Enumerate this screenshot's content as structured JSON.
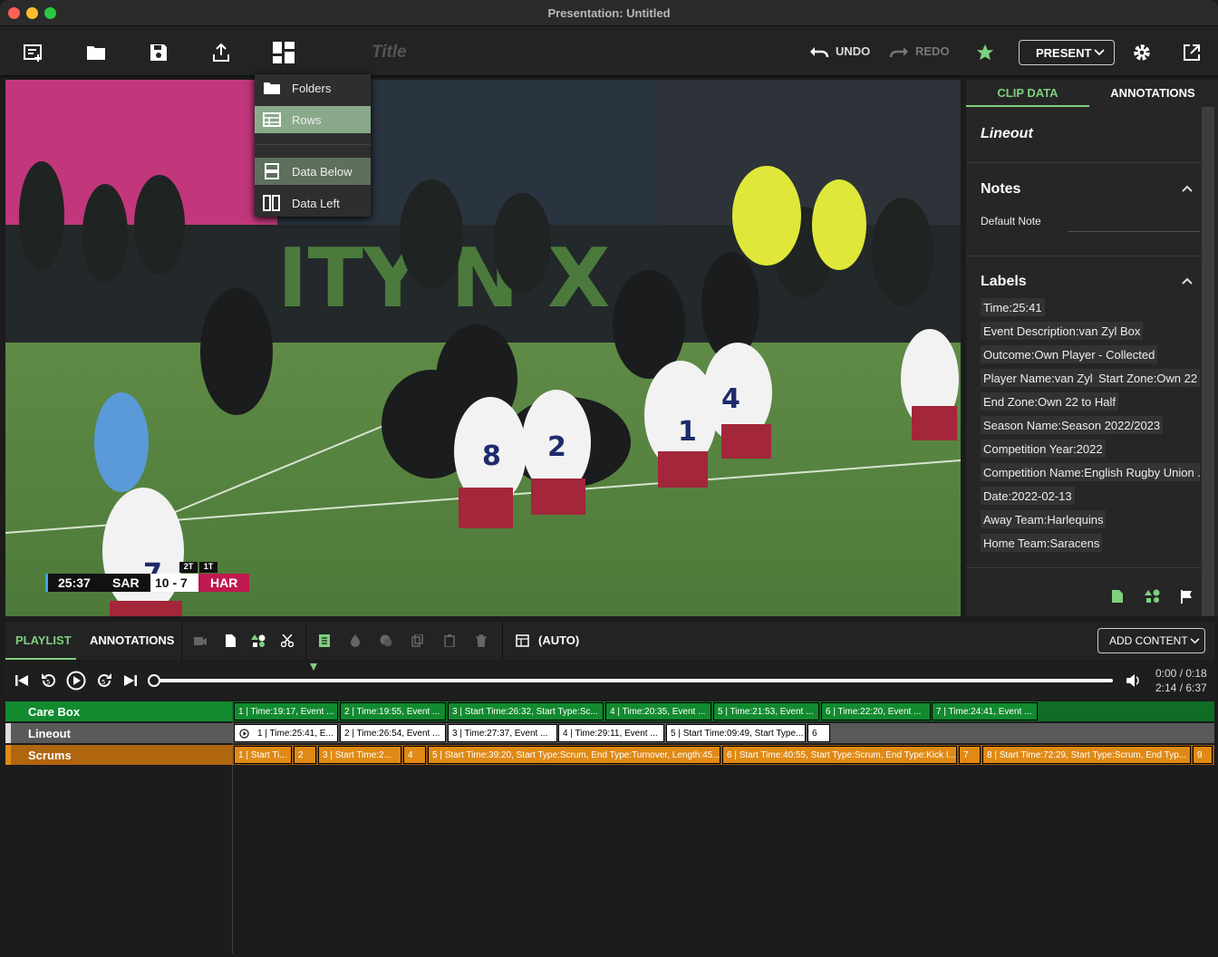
{
  "window": {
    "title": "Presentation: Untitled"
  },
  "toolbar": {
    "title_placeholder": "Title",
    "undo": "UNDO",
    "redo": "REDO",
    "present": "PRESENT"
  },
  "layout_menu": {
    "items": [
      "Folders",
      "Rows",
      "Data Below",
      "Data Left"
    ],
    "selected": "Rows"
  },
  "scoreboard": {
    "clock": "25:37",
    "home": "SAR",
    "score": "10 - 7",
    "away": "HAR",
    "half_2": "2T",
    "half_1": "1T"
  },
  "right_panel": {
    "tabs": [
      "CLIP DATA",
      "ANNOTATIONS"
    ],
    "clip_name": "Lineout",
    "notes_header": "Notes",
    "note_text": "Default Note",
    "labels_header": "Labels",
    "labels": [
      "Time:25:41",
      "Event Description:van Zyl Box",
      "Outcome:Own Player - Collected",
      "Player Name:van Zyl",
      "Start Zone:Own 22",
      "End Zone:Own 22 to Half",
      "Season Name:Season 2022/2023",
      "Competition Year:2022",
      "Competition Name:English Rugby Union ...",
      "Date:2022-02-13",
      "Away Team:Harlequins",
      "Home Team:Saracens"
    ]
  },
  "bottom": {
    "tabs": [
      "PLAYLIST",
      "ANNOTATIONS"
    ],
    "auto_label": "(AUTO)",
    "add_content": "ADD CONTENT",
    "time_current": "0:00 / 0:18",
    "time_total": "2:14 / 6:37",
    "progress": 0.17
  },
  "playlists": [
    {
      "name": "Care Box",
      "color": "#128a2f",
      "clips": [
        "1  | Time:19:17, Event ...",
        "2  | Time:19:55, Event ...",
        "3  | Start Time:26:32, Start Type:Sc...",
        "4  | Time:20:35, Event ...",
        "5  | Time:21:53, Event ...",
        "6  | Time:22:20, Event ...",
        "7  | Time:24:41, Event ..."
      ]
    },
    {
      "name": "Lineout",
      "color": "#5a5a5a",
      "clips": [
        "1  | Time:25:41, E...",
        "2  | Time:26:54, Event ...",
        "3  | Time:27:37, Event ...",
        "4  | Time:29:11, Event ...",
        "5  | Start Time:09:49, Start Type...",
        "6"
      ]
    },
    {
      "name": "Scrums",
      "color": "#b0650f",
      "clips": [
        "1  | Start Ti...",
        "2",
        "3  | Start Time:2...",
        "4",
        "5  | Start Time:39:20, Start Type:Scrum, End Type:Turnover, Length:45...",
        "6  | Start Time:40:55, Start Type:Scrum, End Type:Kick I...",
        "7",
        "8  | Start Time:72:29, Start Type:Scrum, End Typ...",
        "9"
      ]
    }
  ]
}
